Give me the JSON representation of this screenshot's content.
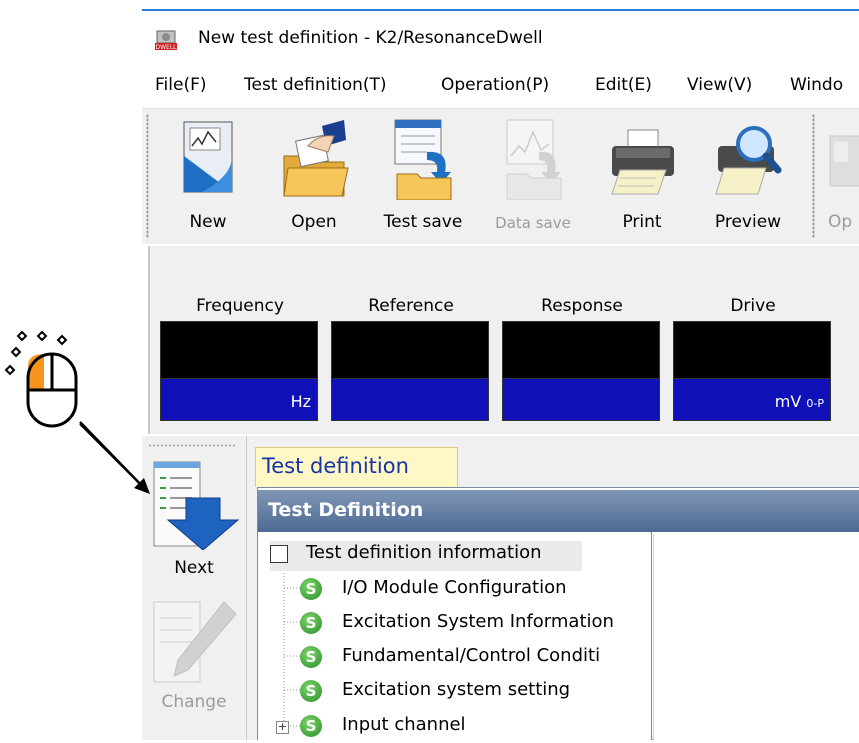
{
  "window": {
    "title": "New test definition - K2/ResonanceDwell",
    "icon": "dwell-app-icon"
  },
  "menu": {
    "items": [
      {
        "label": "File(F)"
      },
      {
        "label": "Test definition(T)"
      },
      {
        "label": "Operation(P)"
      },
      {
        "label": "Edit(E)"
      },
      {
        "label": "View(V)"
      },
      {
        "label": "Windo"
      }
    ]
  },
  "toolbar": {
    "buttons": [
      {
        "label": "New",
        "icon": "new-document-icon",
        "enabled": true
      },
      {
        "label": "Open",
        "icon": "open-folder-icon",
        "enabled": true
      },
      {
        "label": "Test save",
        "icon": "test-save-icon",
        "enabled": true
      },
      {
        "label": "Data save",
        "icon": "data-save-icon",
        "enabled": false
      },
      {
        "label": "Print",
        "icon": "printer-icon",
        "enabled": true
      },
      {
        "label": "Preview",
        "icon": "print-preview-icon",
        "enabled": true
      },
      {
        "label": "Op",
        "icon": "operation-icon",
        "enabled": false
      }
    ]
  },
  "meters": [
    {
      "caption": "Frequency",
      "unit": "Hz",
      "unit_sub": ""
    },
    {
      "caption": "Reference",
      "unit": "",
      "unit_sub": ""
    },
    {
      "caption": "Response",
      "unit": "",
      "unit_sub": ""
    },
    {
      "caption": "Drive",
      "unit": "mV",
      "unit_sub": "0-P"
    }
  ],
  "side_toolbar": {
    "buttons": [
      {
        "label": "Next",
        "icon": "next-arrow-icon",
        "enabled": true
      },
      {
        "label": "Change",
        "icon": "change-pencil-icon",
        "enabled": false
      }
    ]
  },
  "tabs": [
    {
      "label": "Test definition",
      "active": true
    }
  ],
  "panel": {
    "header": "Test Definition",
    "tree": [
      {
        "label": "Test definition information",
        "type": "root"
      },
      {
        "label": "I/O Module Configuration",
        "type": "s"
      },
      {
        "label": "Excitation System Information",
        "type": "s"
      },
      {
        "label": "Fundamental/Control Conditi",
        "type": "s"
      },
      {
        "label": "Excitation system setting",
        "type": "s"
      },
      {
        "label": "Input channel",
        "type": "s-expandable"
      }
    ]
  },
  "colors": {
    "accent": "#2a7fd3",
    "meter_screen": "#000000",
    "meter_unit_bar": "#1010b8",
    "tab_bg": "#fff8c6",
    "tab_text": "#1434a8",
    "panel_header": "#5a7399",
    "mouse_highlight": "#f7941d"
  }
}
